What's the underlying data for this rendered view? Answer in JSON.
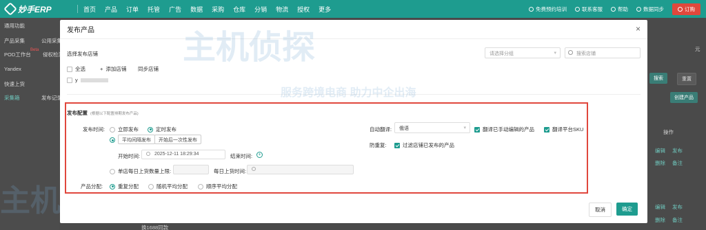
{
  "topbar": {
    "brand": "妙手ERP",
    "nav": [
      "首页",
      "产品",
      "订单",
      "托管",
      "广告",
      "数据",
      "采购",
      "仓库",
      "分销",
      "物流",
      "授权",
      "更多"
    ],
    "right": {
      "training": "免费预约培训",
      "support": "联系客服",
      "help": "帮助",
      "sync": "数据同步",
      "order_button": "订购"
    }
  },
  "background": {
    "sidebar": {
      "common_features": "通用功能",
      "product_collect": "产品采集",
      "public_collect": "公用采集",
      "pod_workbench": "POD工作台",
      "pod_beta": "Beta",
      "infringement_check": "侵权检测",
      "yandex": "Yandex",
      "quick_list": "快速上货",
      "collect_box": "采集箱",
      "publish_record": "发布记录"
    },
    "right": {
      "yuan": "元",
      "search_btn": "搜索",
      "reset_btn": "重置",
      "create_product_btn": "创建产品",
      "col_action": "操作",
      "edit": "编辑",
      "publish": "发布",
      "delete": "删除",
      "note": "备注",
      "bottom_text": "换1688同款"
    }
  },
  "watermark": {
    "brand": "主机侦探",
    "slogan": "服务跨境电商 助力中企出海"
  },
  "modal": {
    "title": "发布产品",
    "close_glyph": "×",
    "store_section_label": "选择发布店铺",
    "select_all": "全选",
    "add_store": "添加店铺",
    "sync_store": "同步店铺",
    "store_name": "y",
    "group_placeholder": "请选择分组",
    "store_search_placeholder": "搜索店铺",
    "config": {
      "title": "发布配置",
      "title_note": "(根据以下配置排期发布产品)",
      "publish_time_label": "发布时间:",
      "opt_now": "立即发布",
      "opt_scheduled": "定时发布",
      "opt_interval": "平均间隔发布",
      "opt_once": "开始后一次性发布",
      "start_time_label": "开始时间:",
      "start_time_value": "2025-12-11 18:29:34",
      "end_time_label": "结束时间:",
      "daily_limit_label": "单店每日上货数量上限:",
      "daily_time_label": "每日上货时间:",
      "distribution_label": "产品分配:",
      "dist_repeat": "重复分配",
      "dist_random": "随机平均分配",
      "dist_order": "顺序平均分配",
      "auto_translate_label": "自动翻译:",
      "translate_value": "俄语",
      "translate_edited": "翻译已手动编辑的产品",
      "translate_sku": "翻译平台SKU",
      "anti_duplicate_label": "防重复:",
      "filter_published": "过滤店铺已发布的产品"
    },
    "cancel_button": "取消",
    "ok_button": "确定"
  },
  "colors": {
    "brand": "#1e9c8f",
    "highlight": "#e0463c",
    "order": "#e0483c"
  }
}
